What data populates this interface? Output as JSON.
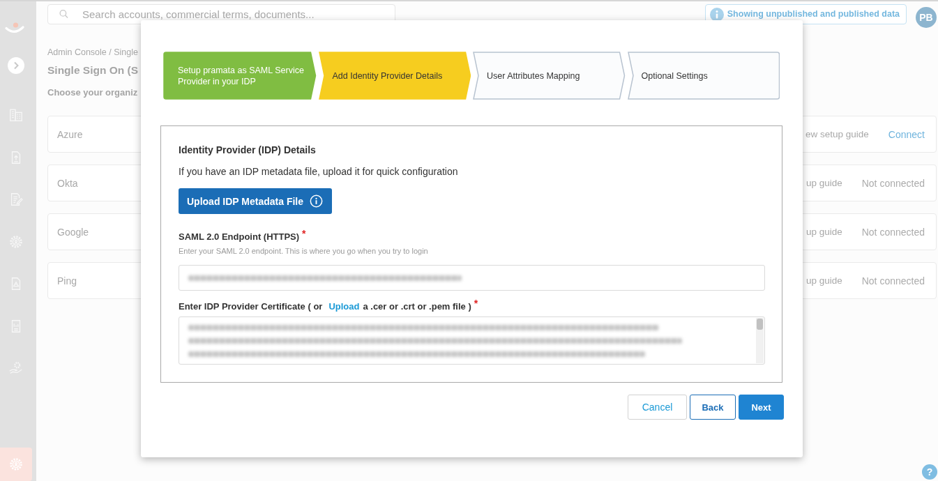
{
  "sidebar": {
    "items": [
      {
        "kind": "buildings",
        "selected": false
      },
      {
        "kind": "upload",
        "selected": false
      },
      {
        "kind": "contract",
        "selected": false
      },
      {
        "kind": "settings",
        "selected": false
      },
      {
        "kind": "alert",
        "selected": false
      },
      {
        "kind": "report",
        "selected": false
      },
      {
        "kind": "services",
        "selected": false
      },
      {
        "kind": "admin",
        "selected": true
      }
    ]
  },
  "header": {
    "search": {
      "placeholder": "Search accounts, commercial terms, documents..."
    },
    "notice": "Showing unpublished and published data",
    "user": {
      "initials": "PB"
    }
  },
  "page": {
    "breadcrumb": "Admin Console / Single",
    "title": "Single Sign On (S",
    "subtitle": "Choose your organiz",
    "providers": [
      {
        "name": "Azure",
        "guide": "ew setup guide",
        "status": "Connect",
        "kind": "link"
      },
      {
        "name": "Okta",
        "guide": "up guide",
        "status": "Not connected",
        "kind": "text"
      },
      {
        "name": "Google",
        "guide": "up guide",
        "status": "Not connected",
        "kind": "text"
      },
      {
        "name": "Ping",
        "guide": "up guide",
        "status": "Not connected",
        "kind": "text"
      }
    ]
  },
  "dialog": {
    "steps": [
      {
        "label": "Setup pramata as SAML Service Provider in your IDP",
        "completed": true,
        "selected": false
      },
      {
        "label": "Add Identity Provider Details",
        "completed": false,
        "selected": true
      },
      {
        "label": "User Attributes Mapping",
        "completed": false,
        "selected": false
      },
      {
        "label": "Optional Settings",
        "completed": false,
        "selected": false
      }
    ],
    "section": {
      "title": "Identity Provider (IDP) Details",
      "intro": "If you have an IDP metadata file, upload it for quick configuration",
      "upload_button": "Upload IDP Metadata File",
      "endpoint": {
        "label": "SAML 2.0 Endpoint (HTTPS)",
        "required_mark": "*",
        "help": "Enter your SAML 2.0 endpoint. This is where you go when you try to login"
      },
      "certificate": {
        "label_before": "Enter IDP Provider Certificate ( or",
        "link": "Upload",
        "label_after": "a .cer or .crt or .pem file )",
        "required_mark": "*"
      }
    },
    "buttons": [
      {
        "label": "Cancel",
        "kind": "cancel"
      },
      {
        "label": "Back",
        "kind": "secondary"
      },
      {
        "label": "Next",
        "kind": "primary"
      }
    ]
  },
  "help_button": "?"
}
